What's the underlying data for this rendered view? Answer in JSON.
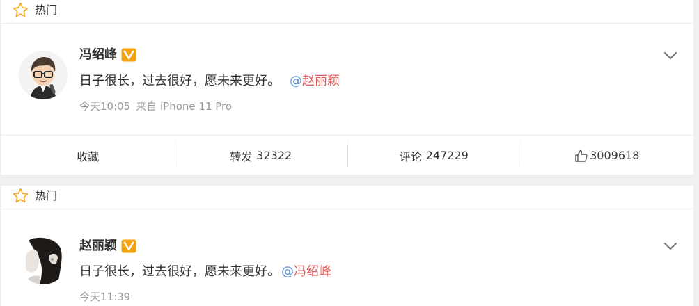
{
  "hot_label": "热门",
  "posts": [
    {
      "author": "冯绍峰",
      "text": "日子很长，过去很好，愿未来更好。",
      "mention_at": "@",
      "mention_name": "赵丽颖",
      "time": "今天10:05",
      "source": "来自 iPhone 11 Pro",
      "actions": {
        "favorite_label": "收藏",
        "repost_label": "转发",
        "repost_count": "32322",
        "comment_label": "评论",
        "comment_count": "247229",
        "like_count": "3009618"
      }
    },
    {
      "author": "赵丽颖",
      "text": "日子很长，过去很好，愿未来更好。",
      "mention_at": "@",
      "mention_name": "冯绍峰",
      "time": "今天11:39"
    }
  ],
  "icons": {
    "hot": "star-icon",
    "verified": "verified-v-badge-icon",
    "menu": "chevron-down-icon",
    "like": "thumbs-up-icon"
  },
  "colors": {
    "star": "#f5a623",
    "verified_badge": "#f2a30f",
    "mention_at": "#5b8fd6",
    "mention_name": "#e35a5a",
    "meta": "#999999"
  }
}
